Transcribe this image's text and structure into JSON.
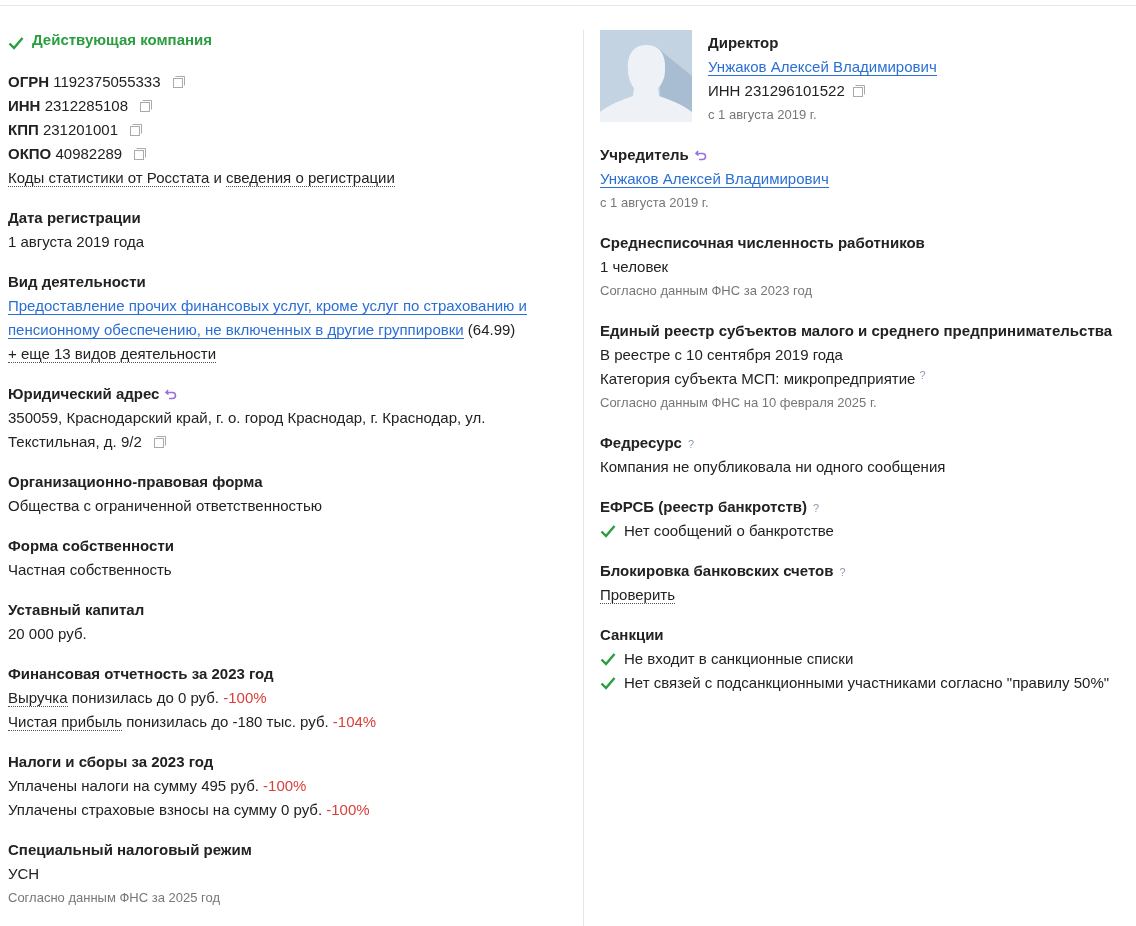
{
  "status": {
    "text": "Действующая компания",
    "active": true
  },
  "left": [
    {
      "lines": [
        {
          "kind": "plain",
          "parts": [
            {
              "kind": "bold",
              "text": "ОГРН"
            },
            {
              "kind": "text",
              "text": "1192375055333"
            },
            {
              "kind": "copy"
            }
          ]
        },
        {
          "kind": "plain",
          "parts": [
            {
              "kind": "bold",
              "text": "ИНН"
            },
            {
              "kind": "text",
              "text": "2312285108"
            },
            {
              "kind": "copy"
            }
          ]
        },
        {
          "kind": "plain",
          "parts": [
            {
              "kind": "bold",
              "text": "КПП"
            },
            {
              "kind": "text",
              "text": "231201001"
            },
            {
              "kind": "copy"
            }
          ]
        },
        {
          "kind": "plain",
          "parts": [
            {
              "kind": "bold",
              "text": "ОКПО"
            },
            {
              "kind": "text",
              "text": "40982289"
            },
            {
              "kind": "copy"
            }
          ]
        },
        {
          "kind": "plain",
          "parts": [
            {
              "kind": "dotted",
              "text": "Коды статистики от Росстата"
            },
            {
              "kind": "text",
              "text": "и"
            },
            {
              "kind": "dotted",
              "text": "сведения о регистрации"
            }
          ]
        }
      ]
    },
    {
      "title": "Дата регистрации",
      "lines": [
        {
          "kind": "plain",
          "parts": [
            {
              "kind": "text",
              "text": "1 августа 2019 года"
            }
          ]
        }
      ]
    },
    {
      "title": "Вид деятельности",
      "lines": [
        {
          "kind": "plain",
          "parts": [
            {
              "kind": "link",
              "text": "Предоставление прочих финансовых услуг, кроме услуг по страхованию и"
            },
            {
              "kind": "link",
              "text": "пенсионному обеспечению, не включенных в другие группировки"
            },
            {
              "kind": "text",
              "text": "(64.99)"
            }
          ]
        },
        {
          "kind": "plain",
          "parts": [
            {
              "kind": "dotted",
              "text": "+ еще 13 видов деятельности"
            }
          ]
        }
      ]
    },
    {
      "title": "Юридический адрес",
      "history": true,
      "lines": [
        {
          "kind": "plain",
          "parts": [
            {
              "kind": "text",
              "text": "350059, Краснодарский край, г. о. город Краснодар, г. Краснодар, ул."
            },
            {
              "kind": "text",
              "text": "Текстильная, д. 9/2"
            },
            {
              "kind": "copy"
            }
          ]
        }
      ]
    },
    {
      "title": "Организационно-правовая форма",
      "lines": [
        {
          "kind": "plain",
          "parts": [
            {
              "kind": "text",
              "text": "Общества с ограниченной ответственностью"
            }
          ]
        }
      ]
    },
    {
      "title": "Форма собственности",
      "lines": [
        {
          "kind": "plain",
          "parts": [
            {
              "kind": "text",
              "text": "Частная собственность"
            }
          ]
        }
      ]
    },
    {
      "title": "Уставный капитал",
      "lines": [
        {
          "kind": "plain",
          "parts": [
            {
              "kind": "text",
              "text": "20 000 руб."
            }
          ]
        }
      ]
    },
    {
      "title": "Финансовая отчетность за 2023 год",
      "lines": [
        {
          "kind": "plain",
          "parts": [
            {
              "kind": "dotted",
              "text": "Выручка"
            },
            {
              "kind": "text",
              "text": "понизилась до 0 руб."
            },
            {
              "kind": "delta",
              "text": "-100%"
            }
          ]
        },
        {
          "kind": "plain",
          "parts": [
            {
              "kind": "dotted",
              "text": "Чистая прибыль"
            },
            {
              "kind": "text",
              "text": "понизилась до -180 тыс. руб."
            },
            {
              "kind": "delta",
              "text": "-104%"
            }
          ]
        }
      ]
    },
    {
      "title": "Налоги и сборы за 2023 год",
      "lines": [
        {
          "kind": "plain",
          "parts": [
            {
              "kind": "text",
              "text": "Уплачены налоги на сумму 495 руб."
            },
            {
              "kind": "delta",
              "text": "-100%"
            }
          ]
        },
        {
          "kind": "plain",
          "parts": [
            {
              "kind": "text",
              "text": "Уплачены страховые взносы на сумму 0 руб."
            },
            {
              "kind": "delta",
              "text": "-100%"
            }
          ]
        }
      ]
    },
    {
      "title": "Специальный налоговый режим",
      "lines": [
        {
          "kind": "plain",
          "parts": [
            {
              "kind": "text",
              "text": "УСН"
            }
          ]
        },
        {
          "kind": "note",
          "parts": [
            {
              "kind": "text",
              "text": "Согласно данным ФНС за 2025 год"
            }
          ]
        }
      ]
    }
  ],
  "director": {
    "role": "Директор",
    "name": "Унжаков Алексей Владимирович",
    "inn": "ИНН 231296101522",
    "since": "с 1 августа 2019 г."
  },
  "right": [
    {
      "title": "Учредитель",
      "history": true,
      "lines": [
        {
          "kind": "plain",
          "parts": [
            {
              "kind": "link",
              "text": "Унжаков Алексей Владимирович"
            }
          ]
        },
        {
          "kind": "note",
          "parts": [
            {
              "kind": "text",
              "text": "с 1 августа 2019 г."
            }
          ]
        }
      ]
    },
    {
      "title": "Среднесписочная численность работников",
      "lines": [
        {
          "kind": "plain",
          "parts": [
            {
              "kind": "text",
              "text": "1 человек"
            }
          ]
        },
        {
          "kind": "note",
          "parts": [
            {
              "kind": "text",
              "text": "Согласно данным ФНС за 2023 год"
            }
          ]
        }
      ]
    },
    {
      "title": "Единый реестр субъектов малого и среднего предпринимательства",
      "lines": [
        {
          "kind": "plain",
          "parts": [
            {
              "kind": "text",
              "text": "В реестре с 10 сентября 2019 года"
            }
          ]
        },
        {
          "kind": "plain",
          "parts": [
            {
              "kind": "text",
              "text": "Категория субъекта МСП: микропредприятие"
            },
            {
              "kind": "help",
              "text": "?"
            }
          ]
        },
        {
          "kind": "note",
          "parts": [
            {
              "kind": "text",
              "text": "Согласно данным ФНС на 10 февраля 2025 г."
            }
          ]
        }
      ]
    },
    {
      "title": "Федресурс",
      "help": "?",
      "lines": [
        {
          "kind": "plain",
          "parts": [
            {
              "kind": "text",
              "text": "Компания не опубликовала ни одного сообщения"
            }
          ]
        }
      ]
    },
    {
      "title": "ЕФРСБ (реестр банкротств)",
      "help": "?",
      "lines": [
        {
          "kind": "check",
          "parts": [
            {
              "kind": "text",
              "text": "Нет сообщений о банкротстве"
            }
          ]
        }
      ]
    },
    {
      "title": "Блокировка банковских счетов",
      "help": "?",
      "lines": [
        {
          "kind": "plain",
          "parts": [
            {
              "kind": "dotted",
              "text": "Проверить"
            }
          ]
        }
      ]
    },
    {
      "title": "Санкции",
      "lines": [
        {
          "kind": "check",
          "parts": [
            {
              "kind": "text",
              "text": "Не входит в санкционные списки"
            }
          ]
        },
        {
          "kind": "check",
          "parts": [
            {
              "kind": "text",
              "text": "Нет связей с подсанкционными участниками согласно \"правилу 50%\""
            }
          ]
        }
      ]
    }
  ]
}
